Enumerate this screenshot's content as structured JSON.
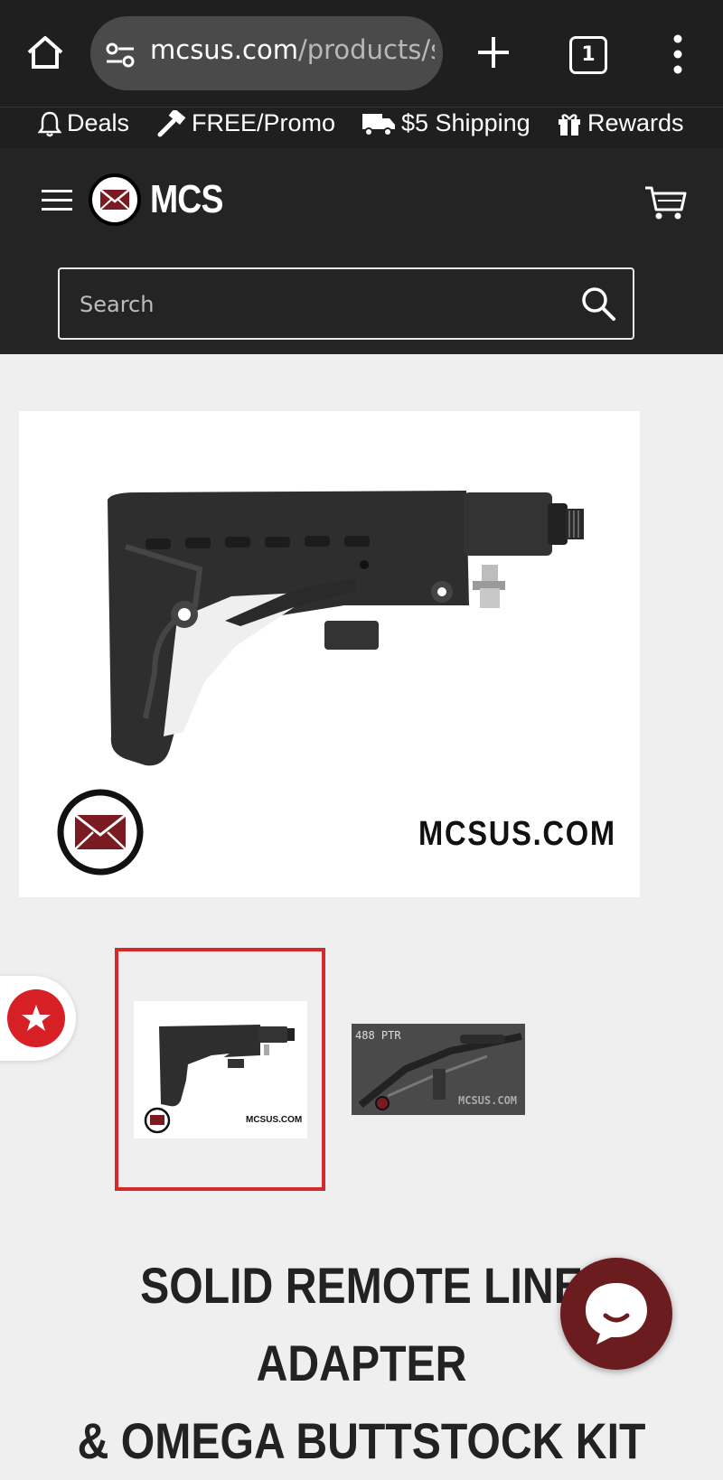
{
  "browser": {
    "url_host": "mcsus.com",
    "url_path": "/products/s",
    "tab_count": "1",
    "icons": [
      "home-icon",
      "site-info-icon",
      "new-tab-icon",
      "tabs-icon",
      "more-vert-icon"
    ]
  },
  "promo_bar": {
    "items": [
      {
        "icon": "bell-icon",
        "label": "Deals"
      },
      {
        "icon": "hammer-icon",
        "label": "FREE/Promo"
      },
      {
        "icon": "truck-icon",
        "label": "$5 Shipping"
      },
      {
        "icon": "gift-icon",
        "label": "Rewards"
      }
    ]
  },
  "header": {
    "logo_text": "MCS",
    "search_placeholder": "Search"
  },
  "product": {
    "watermark": "MCSUS.COM",
    "thumbnails": [
      {
        "selected": true,
        "watermark": "MCSUS.COM"
      },
      {
        "selected": false,
        "label": "488 PTR",
        "watermark": "MCSUS.COM"
      }
    ],
    "title_line1": "SOLID REMOTE LINE ADAPTER",
    "title_line2": "& OMEGA BUTTSTOCK KIT"
  },
  "colors": {
    "header_bg": "#242424",
    "browser_bg": "#1f1f1f",
    "accent_red": "#d71f26",
    "thumb_border": "#d52a2a",
    "chat_bg": "#6b1c1e",
    "page_bg": "#efefef"
  }
}
